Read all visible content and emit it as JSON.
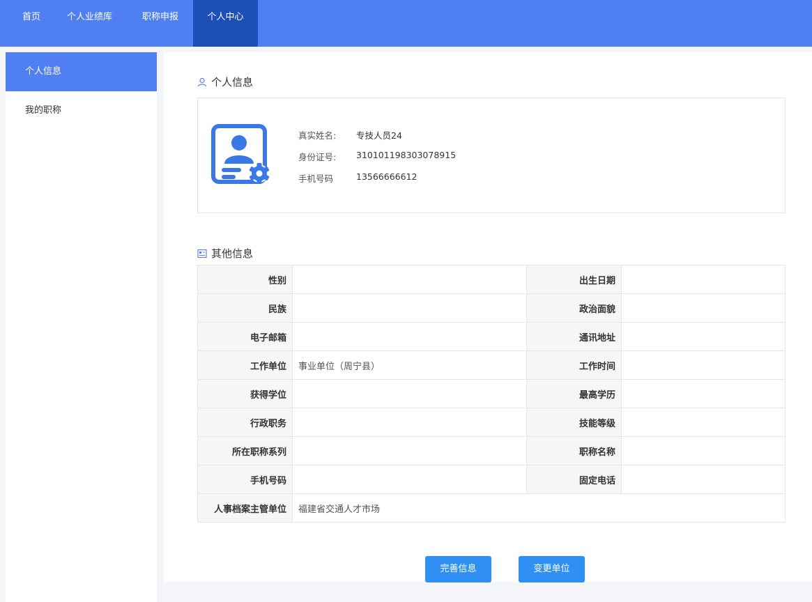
{
  "nav": {
    "items": [
      {
        "label": "首页"
      },
      {
        "label": "个人业绩库"
      },
      {
        "label": "职称申报"
      },
      {
        "label": "个人中心",
        "active": true
      }
    ]
  },
  "sidebar": {
    "items": [
      {
        "label": "个人信息",
        "active": true
      },
      {
        "label": "我的职称"
      }
    ]
  },
  "personal_info": {
    "title": "个人信息",
    "fields": [
      {
        "label": "真实姓名:",
        "value": "专技人员24"
      },
      {
        "label": "身份证号:",
        "value": "310101198303078915"
      },
      {
        "label": "手机号码",
        "value": "13566666612"
      }
    ]
  },
  "other_info": {
    "title": "其他信息",
    "rows": [
      {
        "l1": "性别",
        "v1": "",
        "l2": "出生日期",
        "v2": ""
      },
      {
        "l1": "民族",
        "v1": "",
        "l2": "政治面貌",
        "v2": ""
      },
      {
        "l1": "电子邮箱",
        "v1": "",
        "l2": "通讯地址",
        "v2": ""
      },
      {
        "l1": "工作单位",
        "v1": "事业单位（周宁县）",
        "l2": "工作时间",
        "v2": ""
      },
      {
        "l1": "获得学位",
        "v1": "",
        "l2": "最高学历",
        "v2": ""
      },
      {
        "l1": "行政职务",
        "v1": "",
        "l2": "技能等级",
        "v2": ""
      },
      {
        "l1": "所在职称系列",
        "v1": "",
        "l2": "职称名称",
        "v2": ""
      },
      {
        "l1": "手机号码",
        "v1": "",
        "l2": "固定电话",
        "v2": ""
      }
    ],
    "last_row": {
      "label": "人事档案主管单位",
      "value": "福建省交通人才市场"
    }
  },
  "buttons": {
    "complete": "完善信息",
    "change_unit": "变更单位"
  },
  "colors": {
    "primary": "#4f7ff0",
    "nav_active": "#1d4fb8",
    "button": "#2f8ff3"
  }
}
